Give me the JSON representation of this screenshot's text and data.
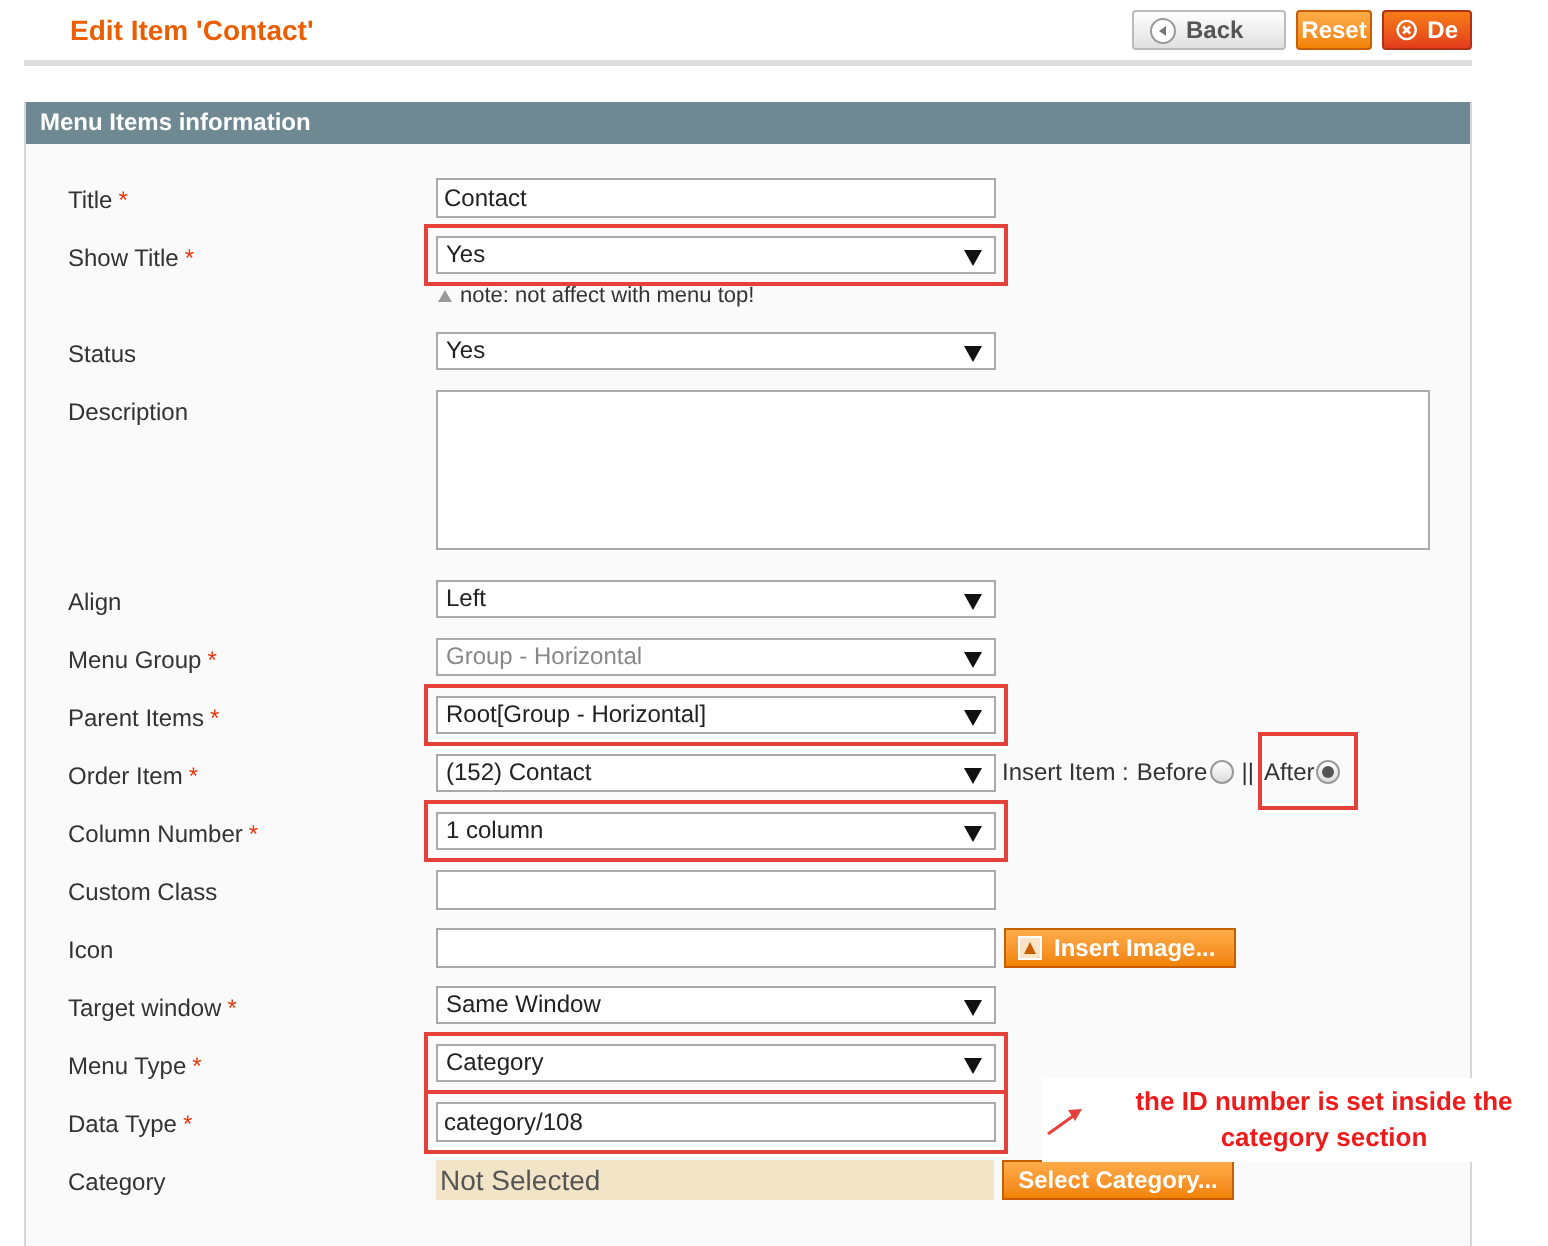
{
  "page": {
    "title": "Edit Item 'Contact'",
    "buttons": [
      {
        "kind": "back",
        "label": "Back"
      },
      {
        "kind": "reset",
        "label": "Reset"
      },
      {
        "kind": "delete",
        "label": "De"
      }
    ]
  },
  "panel": {
    "title": "Menu Items information",
    "fields": [
      {
        "label": "Title",
        "required_mark": "*",
        "kind": "text",
        "value": "Contact",
        "highlighted": false
      },
      {
        "label": "Show Title",
        "required_mark": "*",
        "kind": "select",
        "value": "Yes",
        "highlighted": true,
        "note": "note: not affect with menu top!"
      },
      {
        "label": "Status",
        "kind": "select",
        "value": "Yes",
        "highlighted": false
      },
      {
        "label": "Description",
        "kind": "textarea",
        "highlighted": false
      },
      {
        "label": "Align",
        "kind": "select",
        "value": "Left",
        "highlighted": false
      },
      {
        "label": "Menu Group",
        "required_mark": "*",
        "kind": "select",
        "value": "Group - Horizontal",
        "disabled": true,
        "highlighted": false
      },
      {
        "label": "Parent Items",
        "required_mark": "*",
        "kind": "select",
        "value": "Root[Group - Horizontal]",
        "highlighted": true
      },
      {
        "label": "Order Item",
        "required_mark": "*",
        "kind": "select",
        "value": "(152) Contact",
        "highlighted": false,
        "insert": {
          "label": "Insert Item :",
          "separator": "||",
          "options": [
            {
              "label": "Before",
              "selected": false,
              "highlighted": false
            },
            {
              "label": "After",
              "selected": true,
              "highlighted": true
            }
          ]
        }
      },
      {
        "label": "Column Number",
        "required_mark": "*",
        "kind": "select",
        "value": "1 column",
        "highlighted": true
      },
      {
        "label": "Custom Class",
        "kind": "text",
        "highlighted": false
      },
      {
        "label": "Icon",
        "kind": "text",
        "highlighted": false,
        "button": "Insert Image..."
      },
      {
        "label": "Target window",
        "required_mark": "*",
        "kind": "select",
        "value": "Same Window",
        "highlighted": false
      },
      {
        "label": "Menu Type",
        "required_mark": "*",
        "kind": "select",
        "value": "Category",
        "highlighted": true
      },
      {
        "label": "Data Type",
        "required_mark": "*",
        "kind": "text",
        "value": "category/108",
        "highlighted": true,
        "annotation": "the ID number is set inside the category section"
      },
      {
        "label": "Category",
        "kind": "chooser",
        "value": "Not Selected",
        "highlighted": false,
        "button": "Select Category..."
      }
    ]
  }
}
